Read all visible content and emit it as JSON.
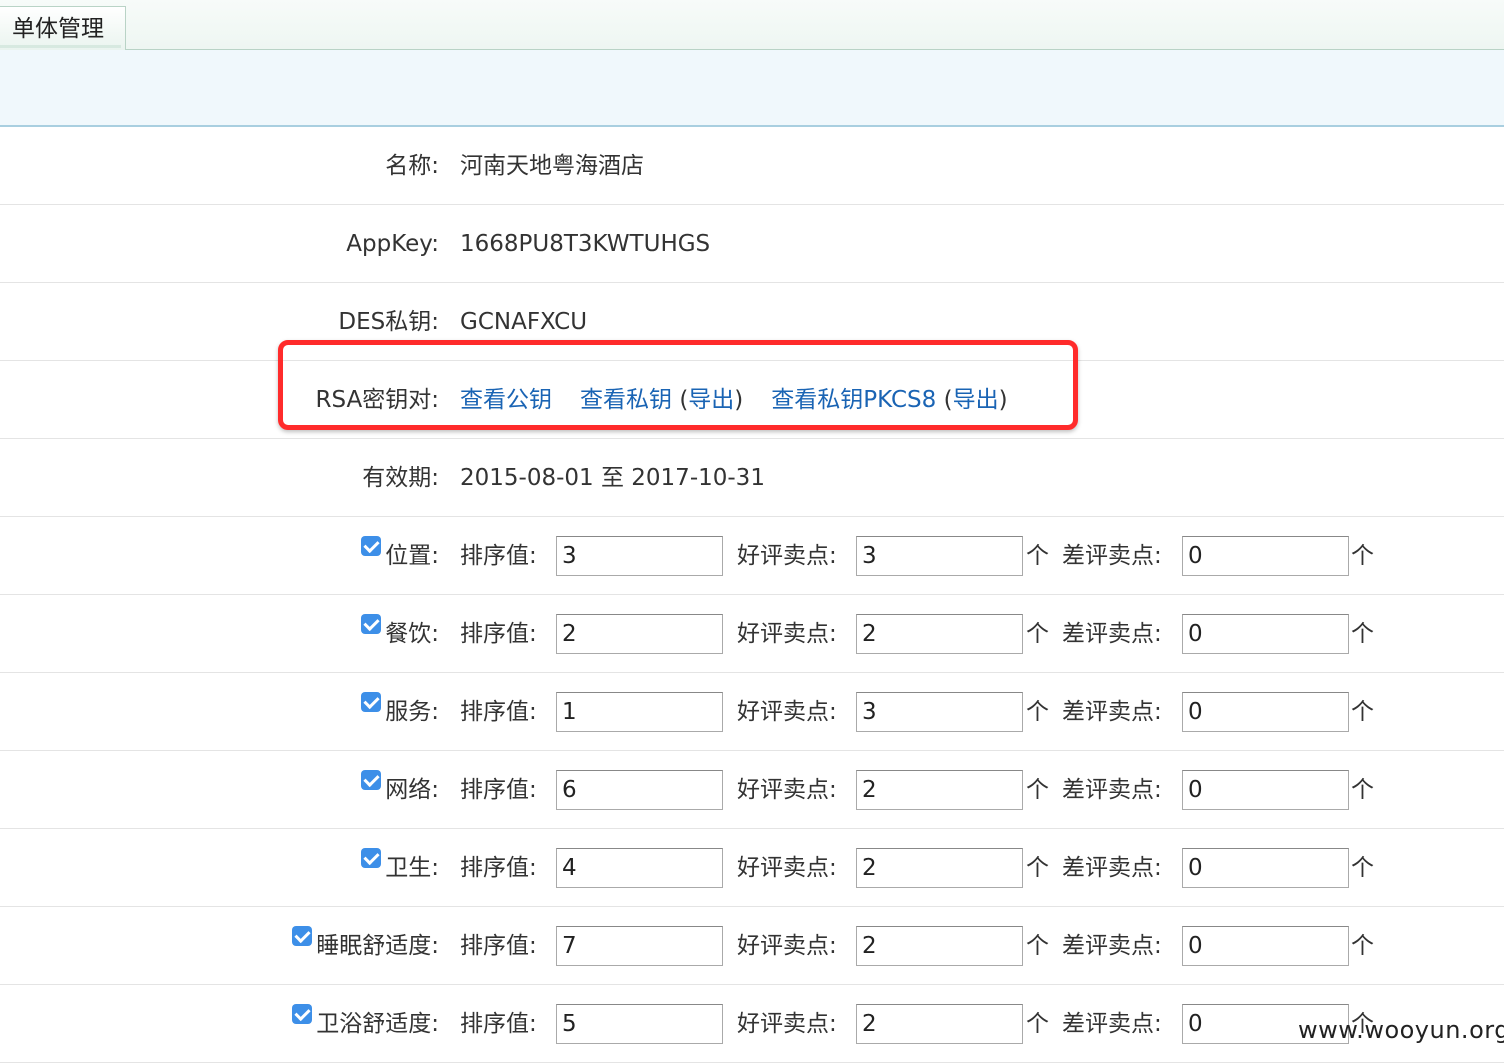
{
  "tab": {
    "label": "单体管理"
  },
  "info": {
    "name": {
      "label": "名称:",
      "value": "河南天地粤海酒店"
    },
    "appkey": {
      "label": "AppKey:",
      "value": "1668PU8T3KWTUHGS"
    },
    "des": {
      "label": "DES私钥:",
      "value": "GCNAFXCU"
    },
    "rsa": {
      "label": "RSA密钥对:",
      "view_public": "查看公钥",
      "view_private": "查看私钥",
      "export1": "导出",
      "view_pkcs8": "查看私钥PKCS8",
      "export2": "导出"
    },
    "validity": {
      "label": "有效期:",
      "value": "2015-08-01 至 2017-10-31"
    }
  },
  "fields": {
    "sort_label": "排序值:",
    "good_label": "好评卖点:",
    "bad_label": "差评卖点:",
    "unit": "个"
  },
  "criteria": [
    {
      "label": "位置:",
      "checked": true,
      "sort": "3",
      "good": "3",
      "bad": "0"
    },
    {
      "label": "餐饮:",
      "checked": true,
      "sort": "2",
      "good": "2",
      "bad": "0"
    },
    {
      "label": "服务:",
      "checked": true,
      "sort": "1",
      "good": "3",
      "bad": "0"
    },
    {
      "label": "网络:",
      "checked": true,
      "sort": "6",
      "good": "2",
      "bad": "0"
    },
    {
      "label": "卫生:",
      "checked": true,
      "sort": "4",
      "good": "2",
      "bad": "0"
    },
    {
      "label": "睡眠舒适度:",
      "checked": true,
      "sort": "7",
      "good": "2",
      "bad": "0"
    },
    {
      "label": "卫浴舒适度:",
      "checked": true,
      "sort": "5",
      "good": "2",
      "bad": "0"
    }
  ],
  "watermark": "www.wooyun.org",
  "colors": {
    "link": "#1a64b4",
    "highlight": "#ff2b2b",
    "checkbox": "#3d8fe8"
  }
}
